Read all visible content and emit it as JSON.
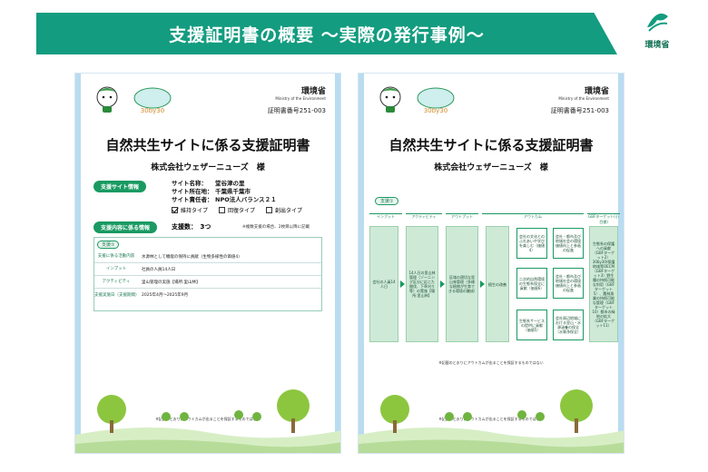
{
  "header": {
    "title": "支援証明書の概要 ～実際の発行事例～",
    "ministry_logo_text": "環境省"
  },
  "left_doc": {
    "ministry_name": "環境省",
    "ministry_en": "Ministry of the Environment",
    "cert_number": "証明書番号251-003",
    "title": "自然共生サイトに係る支援証明書",
    "company": "株式会社ウェザーニューズ　様",
    "section_site": "支援サイト情報",
    "site_rows": [
      {
        "key": "サイト名称：",
        "value": "堂谷津の里"
      },
      {
        "key": "サイト所在地：",
        "value": "千葉県千葉市"
      },
      {
        "key": "サイト責任者：",
        "value": "NPO法人バランス２１"
      }
    ],
    "types": [
      {
        "label": "維持タイプ",
        "checked": true
      },
      {
        "label": "回復タイプ",
        "checked": false
      },
      {
        "label": "創出タイプ",
        "checked": false
      }
    ],
    "section_support": "支援内容に係る情報",
    "support_count": "支援数：　3つ",
    "support_note": "※複数支援の場合、2枚目以降に記載",
    "support_tag": "支援①",
    "table": [
      {
        "key": "支援に係る活動内容",
        "value": "水源林として機能の保持に貢献（生物多様性の価値4）"
      },
      {
        "key": "インプット",
        "value": "社員の人員14人日"
      },
      {
        "key": "アクティビティ",
        "value": "里山管理の実施【場所:里山林】"
      },
      {
        "key": "支援実施日（支援期間）",
        "value": "2025年4月～2025年9月"
      }
    ],
    "footnote": "※記載のとおりにアウトカムが出ることを保証するものではない"
  },
  "right_doc": {
    "ministry_name": "環境省",
    "ministry_en": "Ministry of the Environment",
    "cert_number": "証明書番号251-003",
    "title": "自然共生サイトに係る支援証明書",
    "company": "株式会社ウェザーニューズ　様",
    "flow_tag": "支援①",
    "flow_heads": [
      "インプット",
      "アクティビティ",
      "アウトプット",
      "アウトカム",
      "GBFターゲット(小目標)"
    ],
    "col_input": "会社の人員14人日",
    "col_activity": "14人日の里山林管理（ゾーニング区分に応じた間伐、下草刈り等）の実施【場所:里山林】",
    "col_output": "区域の適切な里山林管理（多様な植物が生育できる環境の醸成）",
    "col_mid": "植生の改善",
    "outcome_a": [
      "会社の文化とのふれあいや学びを楽しむ（価値4）",
      "二次的自然環境の生態系保全に貢献（価値6）",
      "生態系サービスの提供に貢献（価値5）"
    ],
    "outcome_b": [
      "会社・都市及び地域社会の環境価値向上と参画の促進",
      "会社・都市及び地域社会の環境価値向上と参画の促進",
      "会社周辺地域における里山・水源涵養の保全（水質浄保全）"
    ],
    "gbf": "生態系の保護への貢献（GBFターゲット2）30by30/保護地域等OECM（GBFターゲット3）野生種の持続可能な利用（GBFターゲット5）、農林漁業の持続可能な管理（GBFターゲット10）都市の緑地の拡大（GBFターゲット11）",
    "flow_note": "※記載のとおりにアウトカムが出ることを保証するものではない",
    "footnote": "※記載のとおりにアウトカムが出ることを保証するものではない"
  },
  "colors": {
    "banner": "#139c7f",
    "pill": "#1a9a62",
    "flow": "#cfe9d7"
  }
}
